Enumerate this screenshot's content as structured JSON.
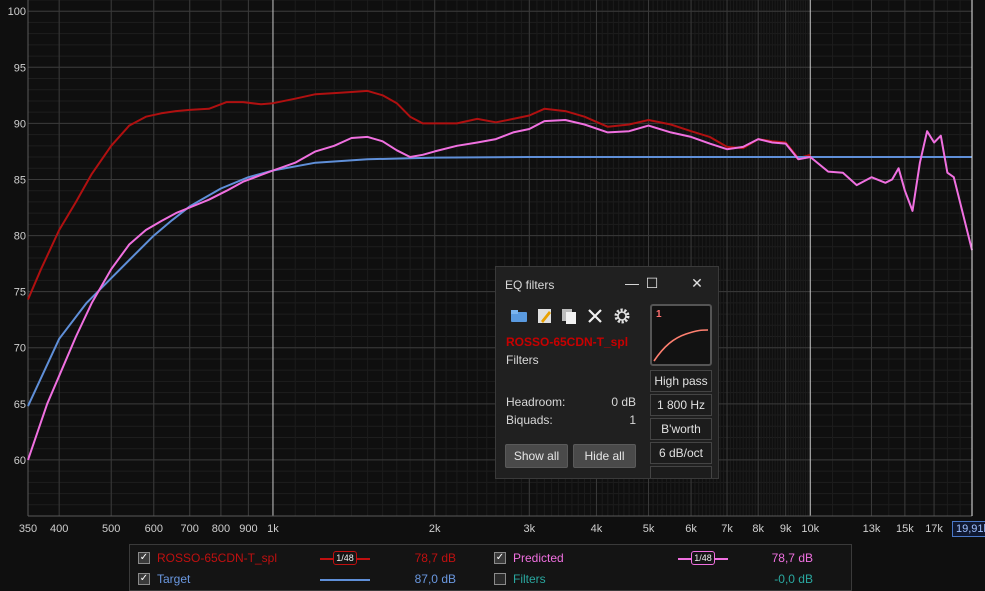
{
  "chart_data": {
    "type": "line",
    "xscale": "log",
    "xlim": [
      350,
      20000
    ],
    "ylim": [
      55,
      101
    ],
    "x_tick_labels": [
      "350",
      "400",
      "500",
      "600",
      "700",
      "800",
      "900",
      "1k",
      "2k",
      "3k",
      "4k",
      "5k",
      "6k",
      "7k",
      "8k",
      "9k",
      "10k",
      "13k",
      "15k",
      "17k"
    ],
    "x_tick_values": [
      350,
      400,
      500,
      600,
      700,
      800,
      900,
      1000,
      2000,
      3000,
      4000,
      5000,
      6000,
      7000,
      8000,
      9000,
      10000,
      13000,
      15000,
      17000
    ],
    "y_tick_values": [
      60,
      65,
      70,
      75,
      80,
      85,
      90,
      95,
      100
    ],
    "series": [
      {
        "name": "ROSSO-65CDN-T_spl",
        "color": "#b01010",
        "x": [
          350,
          370,
          400,
          430,
          460,
          500,
          540,
          580,
          620,
          660,
          700,
          760,
          820,
          880,
          950,
          1000,
          1100,
          1200,
          1300,
          1400,
          1500,
          1600,
          1700,
          1800,
          1900,
          2000,
          2200,
          2400,
          2600,
          2800,
          3000,
          3200,
          3500,
          3800,
          4200,
          4600,
          5000,
          5500,
          6000,
          6500,
          7000,
          7500,
          8000,
          8500,
          9000,
          9500,
          10000
        ],
        "y": [
          74.3,
          77.0,
          80.5,
          83.0,
          85.5,
          88.0,
          89.8,
          90.6,
          90.9,
          91.1,
          91.2,
          91.3,
          91.9,
          91.9,
          91.7,
          91.8,
          92.2,
          92.6,
          92.7,
          92.8,
          92.9,
          92.5,
          91.8,
          90.6,
          90.0,
          90.0,
          90.0,
          90.4,
          90.1,
          90.4,
          90.7,
          91.3,
          91.1,
          90.6,
          89.7,
          89.9,
          90.3,
          89.9,
          89.3,
          88.8,
          87.9,
          87.8,
          88.6,
          88.4,
          88.3,
          86.9,
          87.2
        ]
      },
      {
        "name": "Target",
        "color": "#5f8fd8",
        "x": [
          350,
          400,
          450,
          500,
          550,
          600,
          650,
          700,
          800,
          900,
          1000,
          1200,
          1500,
          2000,
          3000,
          5000,
          10000,
          20000
        ],
        "y": [
          64.8,
          70.8,
          74.0,
          76.2,
          78.2,
          80.0,
          81.4,
          82.6,
          84.2,
          85.2,
          85.8,
          86.5,
          86.8,
          86.95,
          87.0,
          87.0,
          87.0,
          87.0
        ]
      },
      {
        "name": "Predicted",
        "color": "#f070e0",
        "x": [
          350,
          380,
          400,
          430,
          460,
          500,
          540,
          580,
          620,
          660,
          700,
          760,
          820,
          880,
          950,
          1000,
          1100,
          1200,
          1300,
          1400,
          1500,
          1600,
          1700,
          1800,
          1900,
          2000,
          2200,
          2400,
          2600,
          2800,
          3000,
          3200,
          3500,
          3800,
          4200,
          4600,
          5000,
          5500,
          6000,
          6500,
          7000,
          7500,
          8000,
          8500,
          9000,
          9500,
          10000,
          10800,
          11500,
          12200,
          13000,
          13800,
          14200,
          14600,
          15000,
          15500,
          16000,
          16500,
          17000,
          17500,
          18000,
          18500,
          20000
        ],
        "y": [
          60.0,
          65.0,
          67.5,
          71.0,
          74.0,
          77.0,
          79.2,
          80.5,
          81.3,
          82.0,
          82.5,
          83.2,
          84.0,
          84.8,
          85.4,
          85.8,
          86.5,
          87.5,
          88.0,
          88.7,
          88.8,
          88.4,
          87.6,
          87.0,
          87.2,
          87.5,
          88.0,
          88.3,
          88.6,
          89.2,
          89.5,
          90.2,
          90.3,
          89.9,
          89.2,
          89.3,
          89.8,
          89.2,
          88.8,
          88.2,
          87.7,
          87.9,
          88.6,
          88.3,
          88.2,
          86.8,
          87.0,
          85.7,
          85.6,
          84.5,
          85.2,
          84.7,
          85.0,
          86.0,
          84.0,
          82.2,
          86.5,
          89.3,
          88.3,
          88.9,
          85.6,
          85.2,
          78.7
        ]
      }
    ],
    "cursor_readout": "19,91k"
  },
  "eq_window": {
    "title": "EQ filters",
    "minimize_glyph": "—",
    "maximize_glyph": "☐",
    "close_glyph": "✕",
    "measurement_name": "ROSSO-65CDN-T_spl",
    "filters_label": "Filters",
    "headroom_label": "Headroom:",
    "headroom_value": "0 dB",
    "biquads_label": "Biquads:",
    "biquads_value": "1",
    "show_all": "Show all",
    "hide_all": "Hide all",
    "filter_index": "1",
    "filter_type": "High pass",
    "filter_freq": "1 800 Hz",
    "filter_align": "B'worth",
    "filter_slope": "6 dB/oct"
  },
  "legend": {
    "rows": [
      {
        "name": "ROSSO-65CDN-T_spl",
        "checked": true,
        "color": "#b01010",
        "smoothing": "1/48",
        "value": "78,7 dB"
      },
      {
        "name": "Predicted",
        "checked": true,
        "color": "#f070e0",
        "smoothing": "1/48",
        "value": "78,7 dB"
      },
      {
        "name": "Target",
        "checked": true,
        "color": "#5f8fd8",
        "value": "87,0 dB"
      },
      {
        "name": "Filters",
        "checked": false,
        "color": "#2aa8a0",
        "value": "-0,0 dB"
      }
    ]
  }
}
